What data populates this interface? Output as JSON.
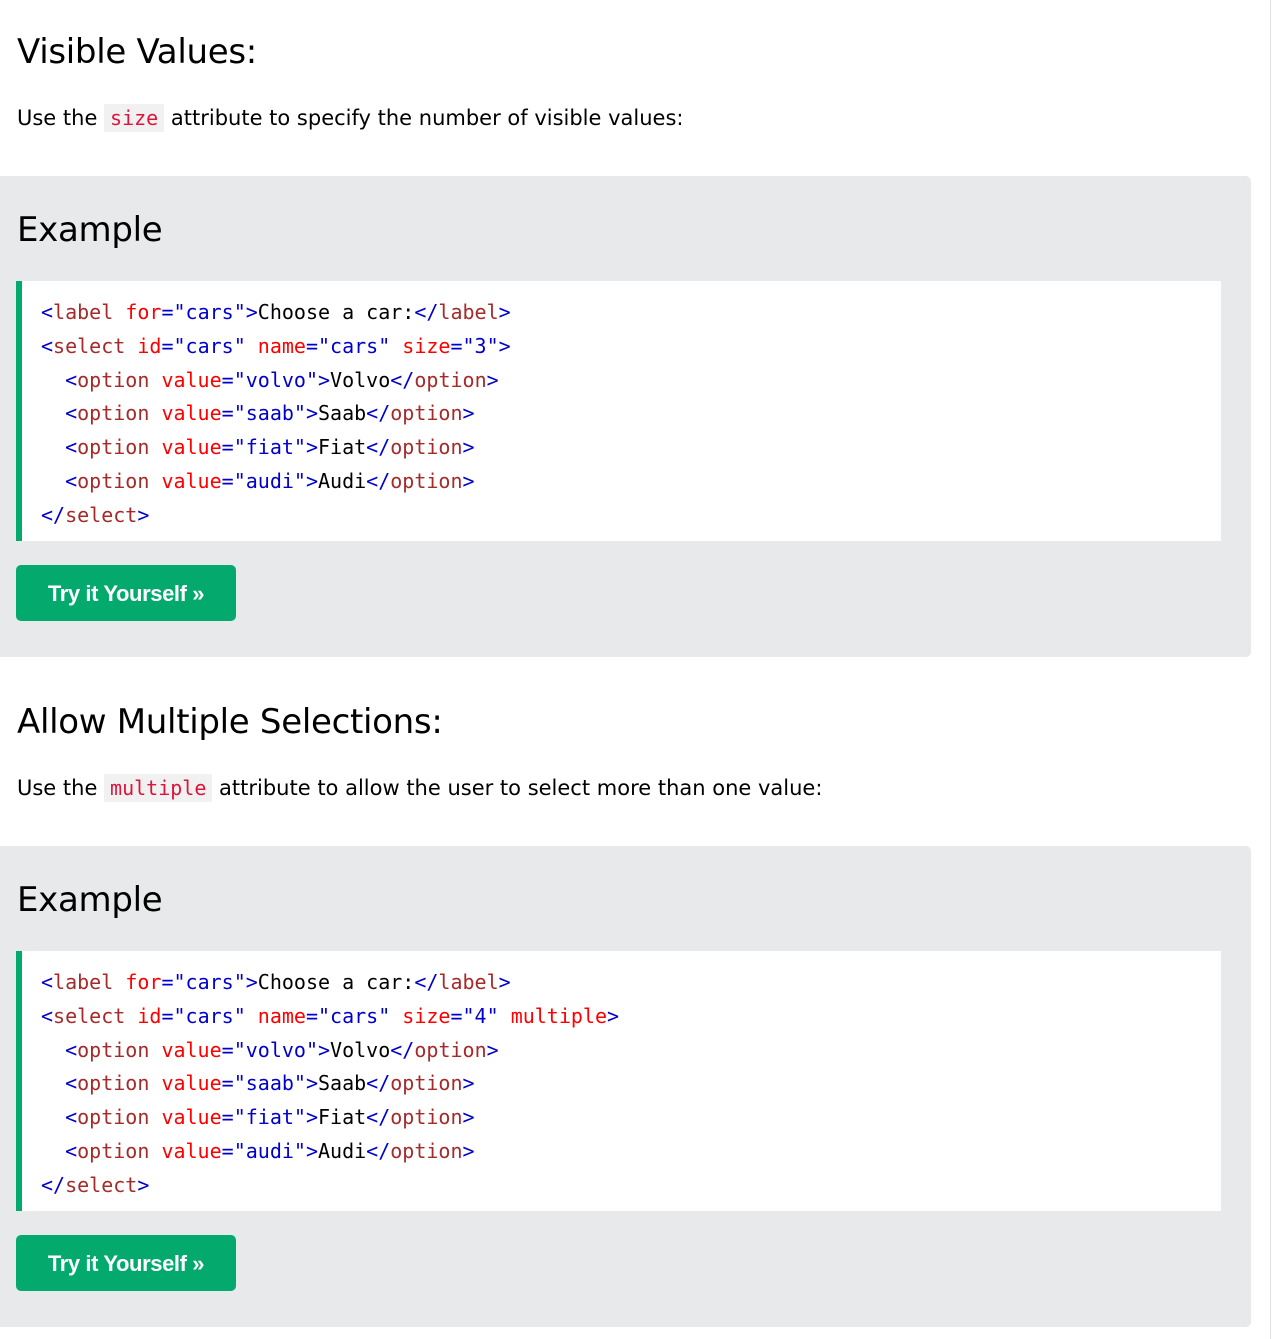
{
  "sections": [
    {
      "title": "Visible Values:",
      "intro_before": "Use the ",
      "intro_code": "size",
      "intro_after": " attribute to specify the number of visible values:",
      "example_title": "Example",
      "button_label": "Try it Yourself »",
      "code": {
        "l1": {
          "open": "<",
          "tag": "label",
          "sp": " ",
          "attr1": "for",
          "eq1": "=",
          "val1": "\"cars\"",
          "close": ">",
          "text": "Choose a car:",
          "end_open": "</",
          "end_tag": "label",
          "end_close": ">"
        },
        "l2": {
          "open": "<",
          "tag": "select",
          "a1": "id",
          "v1": "\"cars\"",
          "a2": "name",
          "v2": "\"cars\"",
          "a3": "size",
          "v3": "\"3\"",
          "a4": "",
          "close": ">"
        },
        "options": [
          {
            "value": "\"volvo\"",
            "text": "Volvo"
          },
          {
            "value": "\"saab\"",
            "text": "Saab"
          },
          {
            "value": "\"fiat\"",
            "text": "Fiat"
          },
          {
            "value": "\"audi\"",
            "text": "Audi"
          }
        ],
        "end_select": "select"
      }
    },
    {
      "title": "Allow Multiple Selections:",
      "intro_before": "Use the ",
      "intro_code": "multiple",
      "intro_after": " attribute to allow the user to select more than one value:",
      "example_title": "Example",
      "button_label": "Try it Yourself »",
      "code": {
        "l1": {
          "open": "<",
          "tag": "label",
          "sp": " ",
          "attr1": "for",
          "eq1": "=",
          "val1": "\"cars\"",
          "close": ">",
          "text": "Choose a car:",
          "end_open": "</",
          "end_tag": "label",
          "end_close": ">"
        },
        "l2": {
          "open": "<",
          "tag": "select",
          "a1": "id",
          "v1": "\"cars\"",
          "a2": "name",
          "v2": "\"cars\"",
          "a3": "size",
          "v3": "\"4\"",
          "a4": "multiple",
          "close": ">"
        },
        "options": [
          {
            "value": "\"volvo\"",
            "text": "Volvo"
          },
          {
            "value": "\"saab\"",
            "text": "Saab"
          },
          {
            "value": "\"fiat\"",
            "text": "Fiat"
          },
          {
            "value": "\"audi\"",
            "text": "Audi"
          }
        ],
        "end_select": "select"
      }
    }
  ],
  "syntax": {
    "option_tag": "option",
    "value_attr": "value",
    "lt": "<",
    "gt": ">",
    "lt_slash": "</",
    "eq": "="
  },
  "colors": {
    "accent_green": "#04aa6d",
    "example_bg": "#e7e9eb",
    "inline_code_color": "#dc143c",
    "tag_bracket": "#0000cd",
    "tag_name": "#a52a2a",
    "attr_name": "#ff0000",
    "attr_value": "#0000cd"
  }
}
